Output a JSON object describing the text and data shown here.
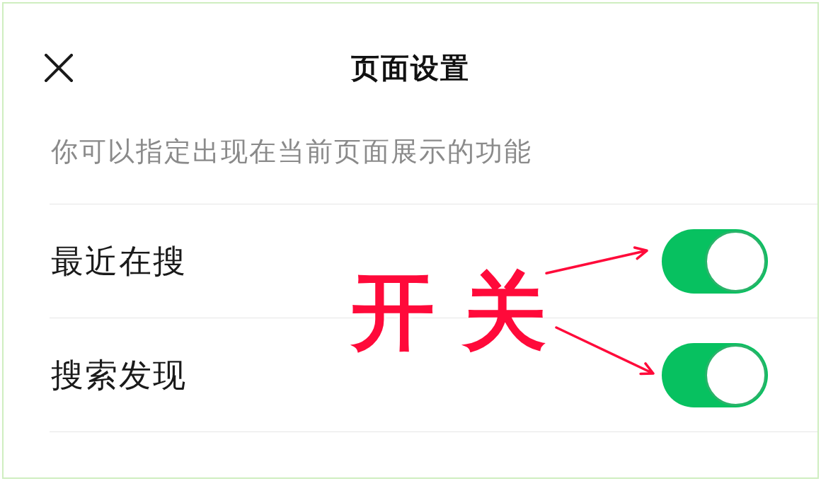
{
  "header": {
    "title": "页面设置"
  },
  "description": "你可以指定出现在当前页面展示的功能",
  "settings": [
    {
      "label": "最近在搜",
      "on": true
    },
    {
      "label": "搜索发现",
      "on": true
    }
  ],
  "annotation": {
    "label": "开关"
  }
}
